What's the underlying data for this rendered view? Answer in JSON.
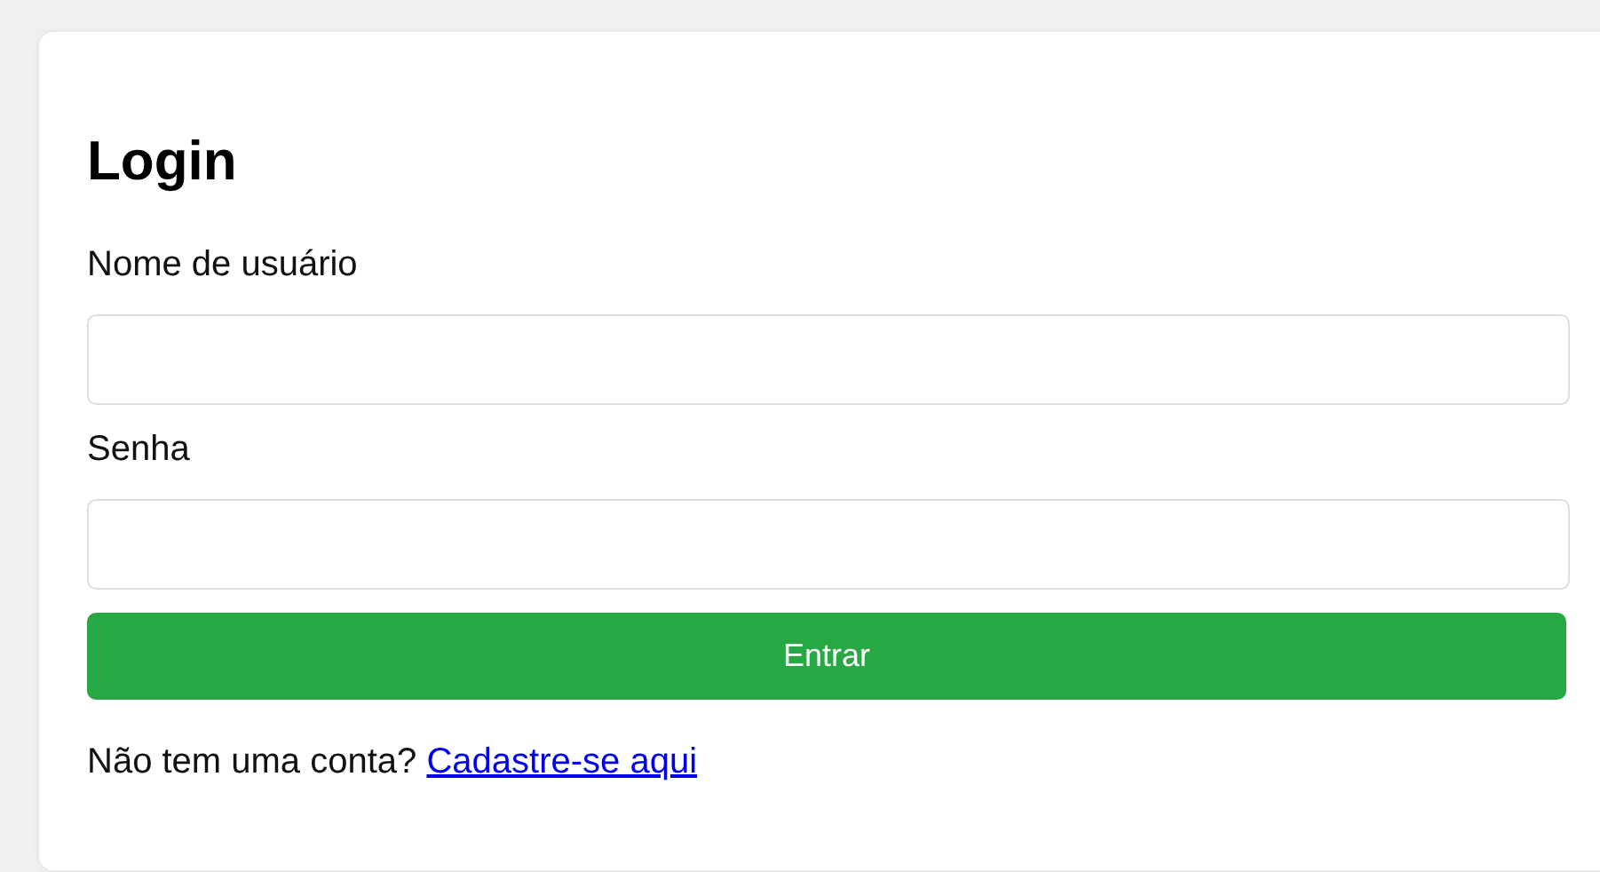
{
  "title": "Login",
  "fields": [
    {
      "label": "Nome de usuário"
    },
    {
      "label": "Senha"
    }
  ],
  "button": "Entrar",
  "footer": {
    "text": "Não tem uma conta? ",
    "link": "Cadastre-se aqui"
  }
}
